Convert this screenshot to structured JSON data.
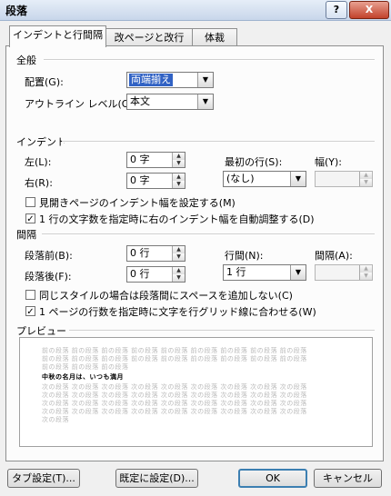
{
  "window": {
    "title": "段落",
    "help_label": "?",
    "close_label": "X"
  },
  "tabs": [
    {
      "label": "インデントと行間隔"
    },
    {
      "label": "改ページと改行"
    },
    {
      "label": "体裁"
    }
  ],
  "general": {
    "heading": "全般",
    "alignment_label": "配置(G):",
    "alignment_value": "両端揃え",
    "outline_label": "アウトライン レベル(O):",
    "outline_value": "本文"
  },
  "indent": {
    "heading": "インデント",
    "left_label": "左(L):",
    "left_value": "0 字",
    "right_label": "右(R):",
    "right_value": "0 字",
    "first_line_label": "最初の行(S):",
    "first_line_value": "(なし)",
    "width_label": "幅(Y):",
    "width_value": "",
    "mirror_label": "見開きページのインデント幅を設定する(M)",
    "mirror_checked": false,
    "auto_adjust_label": "1 行の文字数を指定時に右のインデント幅を自動調整する(D)",
    "auto_adjust_checked": true
  },
  "spacing": {
    "heading": "間隔",
    "before_label": "段落前(B):",
    "before_value": "0 行",
    "after_label": "段落後(F):",
    "after_value": "0 行",
    "line_spacing_label": "行間(N):",
    "line_spacing_value": "1 行",
    "at_label": "間隔(A):",
    "at_value": "",
    "no_space_label": "同じスタイルの場合は段落間にスペースを追加しない(C)",
    "no_space_checked": false,
    "snap_grid_label": "1 ページの行数を指定時に文字を行グリッド線に合わせる(W)",
    "snap_grid_checked": true
  },
  "preview": {
    "heading": "プレビュー",
    "lines": [
      "前の段落 前の段落 前の段落 前の段落 前の段落 前の段落 前の段落 前の段落 前の段落",
      "前の段落 前の段落 前の段落 前の段落 前の段落 前の段落 前の段落 前の段落 前の段落",
      "前の段落 前の段落 前の段落",
      "中秋の名月は、いつも満月",
      "次の段落 次の段落 次の段落 次の段落 次の段落 次の段落 次の段落 次の段落 次の段落",
      "次の段落 次の段落 次の段落 次の段落 次の段落 次の段落 次の段落 次の段落 次の段落",
      "次の段落 次の段落 次の段落 次の段落 次の段落 次の段落 次の段落 次の段落 次の段落",
      "次の段落 次の段落 次の段落 次の段落 次の段落 次の段落 次の段落 次の段落 次の段落",
      "次の段落"
    ]
  },
  "buttons": {
    "tabs": "タブ設定(T)...",
    "default": "既定に設定(D)...",
    "ok": "OK",
    "cancel": "キャンセル"
  },
  "icons": {
    "dropdown": "chevron-down-icon",
    "check": "checkmark-icon"
  },
  "colors": {
    "selection": "#3162c4",
    "default_button_border": "#3c7fb1"
  }
}
